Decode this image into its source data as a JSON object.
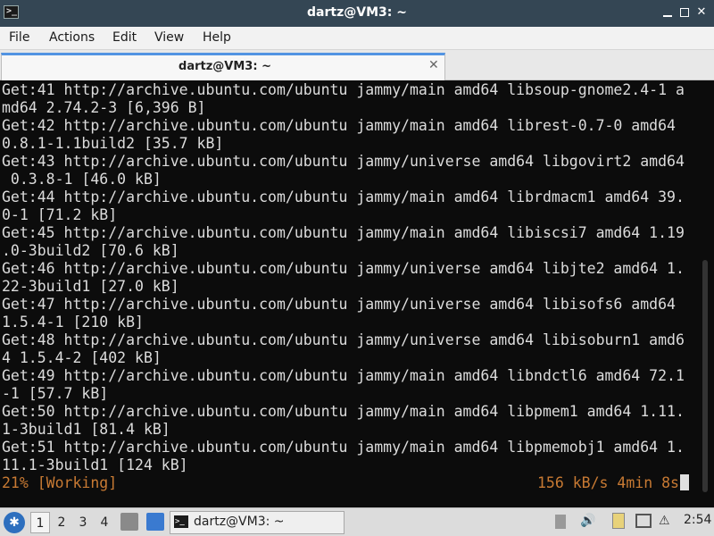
{
  "window": {
    "title": "dartz@VM3: ~",
    "minimize_glyph": "",
    "maximize_glyph": "",
    "close_glyph": "✕"
  },
  "menu": {
    "file": "File",
    "actions": "Actions",
    "edit": "Edit",
    "view": "View",
    "help": "Help"
  },
  "tab": {
    "label": "dartz@VM3: ~",
    "close_glyph": "✕"
  },
  "terminal": {
    "lines": [
      "Get:41 http://archive.ubuntu.com/ubuntu jammy/main amd64 libsoup-gnome2.4-1 a",
      "md64 2.74.2-3 [6,396 B]",
      "Get:42 http://archive.ubuntu.com/ubuntu jammy/main amd64 librest-0.7-0 amd64",
      "0.8.1-1.1build2 [35.7 kB]",
      "Get:43 http://archive.ubuntu.com/ubuntu jammy/universe amd64 libgovirt2 amd64",
      " 0.3.8-1 [46.0 kB]",
      "Get:44 http://archive.ubuntu.com/ubuntu jammy/main amd64 librdmacm1 amd64 39.",
      "0-1 [71.2 kB]",
      "Get:45 http://archive.ubuntu.com/ubuntu jammy/main amd64 libiscsi7 amd64 1.19",
      ".0-3build2 [70.6 kB]",
      "Get:46 http://archive.ubuntu.com/ubuntu jammy/universe amd64 libjte2 amd64 1.",
      "22-3build1 [27.0 kB]",
      "Get:47 http://archive.ubuntu.com/ubuntu jammy/universe amd64 libisofs6 amd64",
      "1.5.4-1 [210 kB]",
      "Get:48 http://archive.ubuntu.com/ubuntu jammy/universe amd64 libisoburn1 amd6",
      "4 1.5.4-2 [402 kB]",
      "Get:49 http://archive.ubuntu.com/ubuntu jammy/main amd64 libndctl6 amd64 72.1",
      "-1 [57.7 kB]",
      "Get:50 http://archive.ubuntu.com/ubuntu jammy/main amd64 libpmem1 amd64 1.11.",
      "1-3build1 [81.4 kB]",
      "Get:51 http://archive.ubuntu.com/ubuntu jammy/main amd64 libpmemobj1 amd64 1.",
      "11.1-3build1 [124 kB]"
    ],
    "status_left": "21% [Working]",
    "status_right": "156 kB/s 4min 8s",
    "status_color": "#c87a33"
  },
  "taskbar": {
    "workspaces": [
      "1",
      "2",
      "3",
      "4"
    ],
    "active_workspace": "1",
    "task_label": "dartz@VM3: ~",
    "clock": "2:54",
    "icons": [
      "start-menu-icon",
      "file-manager-icon",
      "show-desktop-icon",
      "terminal-icon",
      "removable-drive-icon",
      "volume-icon",
      "clipboard-icon",
      "network-icon",
      "notifications-icon"
    ]
  }
}
